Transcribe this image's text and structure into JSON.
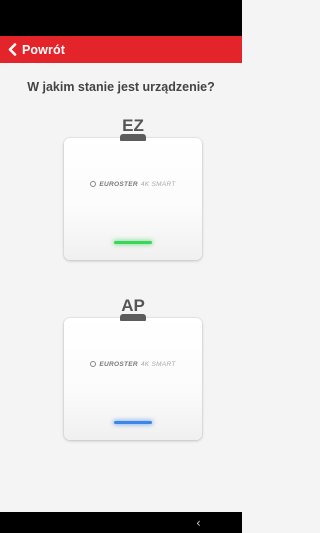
{
  "header": {
    "back_label": "Powrót"
  },
  "question": "W jakim stanie jest urządzenie?",
  "modes": [
    {
      "label": "EZ",
      "brand": "EUROSTER",
      "model": "4K SMART",
      "led_color": "#3ad65a",
      "led_glow": "rgba(58,214,90,0.55)"
    },
    {
      "label": "AP",
      "brand": "EUROSTER",
      "model": "4K SMART",
      "led_color": "#3c86e8",
      "led_glow": "rgba(60,134,232,0.55)"
    }
  ],
  "navigation": {
    "back_glyph": "‹"
  }
}
